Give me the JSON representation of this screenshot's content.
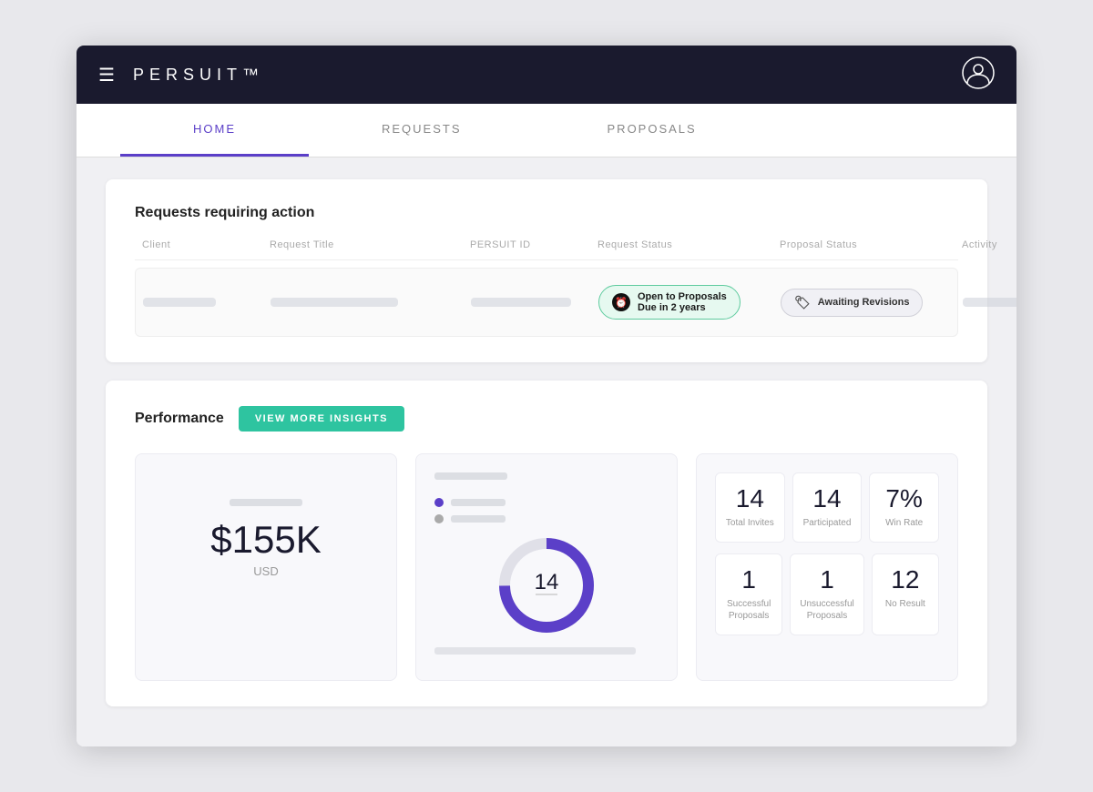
{
  "browser": {
    "background": "#e8e8ec"
  },
  "header": {
    "logo": "PERSUIT™",
    "logo_tm": "™"
  },
  "tabs": [
    {
      "id": "home",
      "label": "HOME",
      "active": true
    },
    {
      "id": "requests",
      "label": "REQUESTS",
      "active": false
    },
    {
      "id": "proposals",
      "label": "PROPOSALS",
      "active": false
    }
  ],
  "requests_section": {
    "title": "Requests requiring action",
    "columns": [
      "Client",
      "Request Title",
      "PERSUIT ID",
      "Request Status",
      "Proposal Status",
      "Activity"
    ],
    "row": {
      "request_status": {
        "label": "Open to Proposals",
        "sublabel": "Due in 2 years"
      },
      "proposal_status": {
        "label": "Awaiting Revisions"
      }
    }
  },
  "performance_section": {
    "title": "Performance",
    "insights_btn": "VIEW MORE INSIGHTS",
    "dollar_value": "$155K",
    "dollar_unit": "USD",
    "donut_number": "14",
    "legend": [
      {
        "color": "#5b3fc8",
        "label": ""
      },
      {
        "color": "#aaa",
        "label": ""
      }
    ],
    "stats_top": [
      {
        "number": "14",
        "label": "Total Invites"
      },
      {
        "number": "14",
        "label": "Participated"
      },
      {
        "number": "7%",
        "label": "Win Rate"
      }
    ],
    "stats_bottom": [
      {
        "number": "1",
        "label": "Successful Proposals"
      },
      {
        "number": "1",
        "label": "Unsuccessful Proposals"
      },
      {
        "number": "12",
        "label": "No Result"
      }
    ]
  }
}
